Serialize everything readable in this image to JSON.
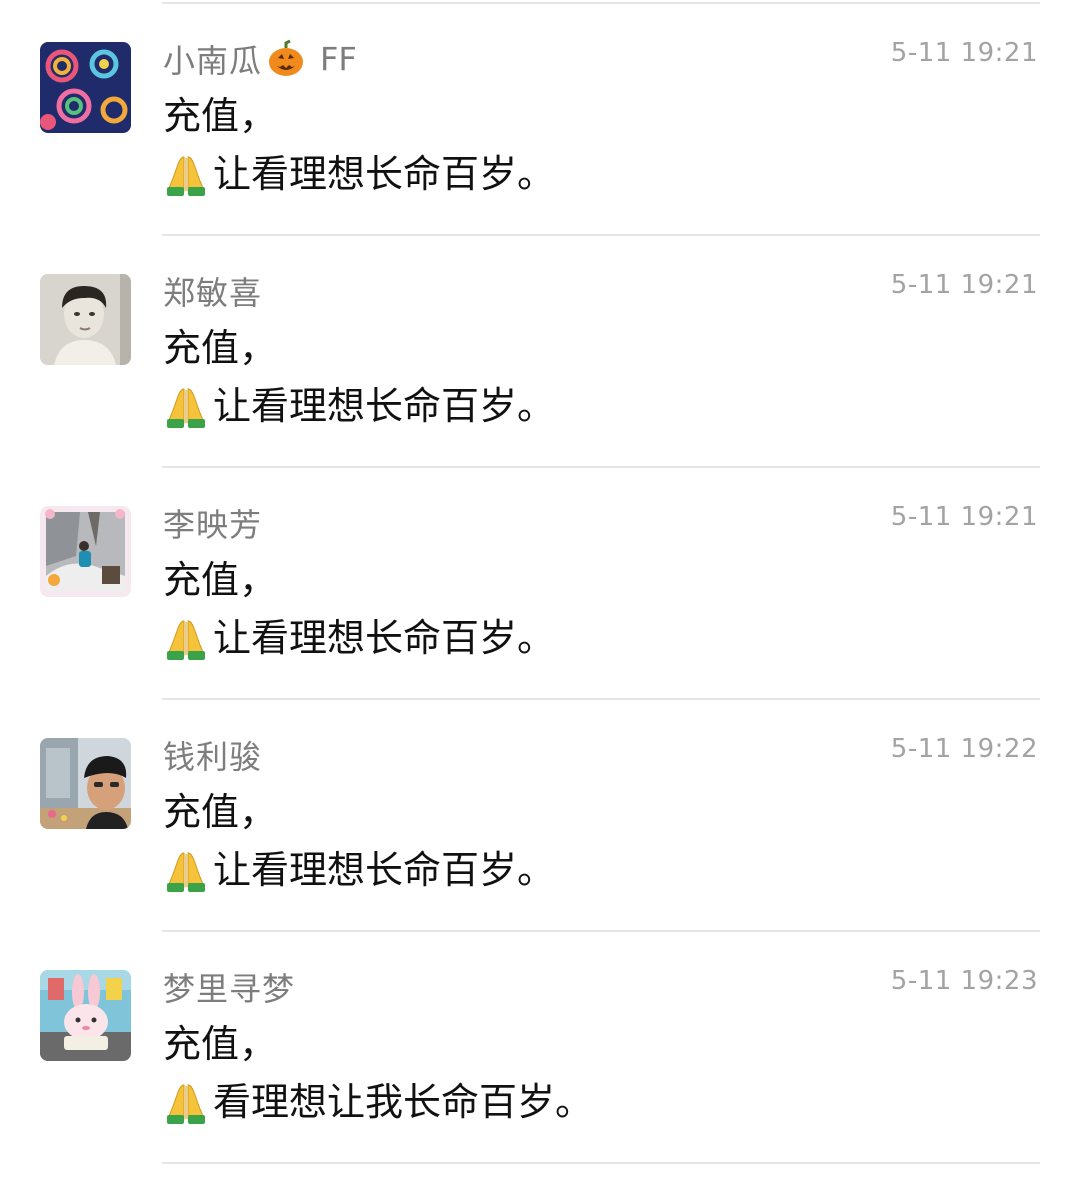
{
  "feed": {
    "items": [
      {
        "name": "小南瓜",
        "name_emoji": "pumpkin-icon",
        "name_suffix": "FF",
        "time": "5-11 19:21",
        "line1": "充值，",
        "line2_emoji": "folded-hands-icon",
        "line2": "让看理想长命百岁。",
        "avatar": "pattern-avatar"
      },
      {
        "name": "郑敏喜",
        "time": "5-11 19:21",
        "line1": "充值，",
        "line2_emoji": "folded-hands-icon",
        "line2": "让看理想长命百岁。",
        "avatar": "portrait-avatar"
      },
      {
        "name": "李映芳",
        "time": "5-11 19:21",
        "line1": "充值，",
        "line2_emoji": "folded-hands-icon",
        "line2": "让看理想长命百岁。",
        "avatar": "outdoor-photo-avatar"
      },
      {
        "name": "钱利骏",
        "time": "5-11 19:22",
        "line1": "充值，",
        "line2_emoji": "folded-hands-icon",
        "line2": "让看理想长命百岁。",
        "avatar": "selfie-avatar"
      },
      {
        "name": "梦里寻梦",
        "time": "5-11 19:23",
        "line1": "充值，",
        "line2_emoji": "folded-hands-icon",
        "line2": "看理想让我长命百岁。",
        "avatar": "cartoon-rabbit-avatar"
      }
    ]
  },
  "colors": {
    "name": "#7d7d7d",
    "time": "#a3a3a3",
    "message": "#111111",
    "divider": "#e6e6e6"
  }
}
